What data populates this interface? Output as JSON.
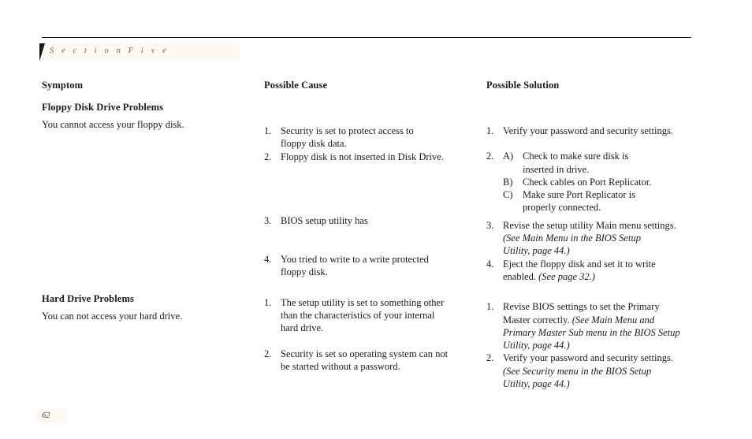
{
  "header": {
    "section_label": "S e c t i o n     F i v e"
  },
  "columns": {
    "symptom_heading": "Symptom",
    "cause_heading": "Possible Cause",
    "solution_heading": "Possible Solution"
  },
  "sections": [
    {
      "title": "Floppy Disk Drive Problems",
      "symptom": "You cannot access your floppy disk.",
      "causes": [
        {
          "mark": "1.",
          "text": "Security is set to protect access to",
          "cont": "floppy disk data."
        },
        {
          "mark": "2.",
          "text": "Floppy disk is not inserted in Disk Drive.",
          "cont": ""
        },
        {
          "mark": "3.",
          "text": "BIOS setup utility has",
          "cont": ""
        },
        {
          "mark": "4.",
          "text": "You tried to write to a write protected",
          "cont": "floppy disk."
        }
      ],
      "solutions": [
        {
          "mark": "1.",
          "text": "Verify your password and security settings.",
          "cont": ""
        },
        {
          "mark": "2.",
          "sub_mark": "A)",
          "text": "Check to make sure disk is",
          "cont": "inserted in drive."
        },
        {
          "mark": "",
          "sub_mark": "B)",
          "text": "Check cables on Port Replicator.",
          "cont": ""
        },
        {
          "mark": "",
          "sub_mark": "C)",
          "text": "Make sure Port Replicator is",
          "cont": "properly connected."
        },
        {
          "mark": "3.",
          "text": "Revise the setup utility Main menu settings.",
          "italic1": "(See Main Menu in the BIOS Setup",
          "italic2": "Utility, page 44.)"
        },
        {
          "mark": "4.",
          "text": "Eject the floppy disk and set it to write",
          "cont_plain": "enabled. ",
          "cont_italic": "(See page 32.)"
        }
      ]
    },
    {
      "title": "Hard Drive Problems",
      "symptom": "You can not access your hard drive.",
      "causes": [
        {
          "mark": "1.",
          "text": "The setup utility is set to something other",
          "cont": "than the characteristics of your internal",
          "cont2": "hard drive."
        },
        {
          "mark": "2.",
          "text": "Security is set so operating system can not",
          "cont": "be started without a password."
        }
      ],
      "solutions": [
        {
          "mark": "1.",
          "text": "Revise BIOS settings to set the Primary",
          "cont_plain": "Master correctly. ",
          "cont_italic": "(See Main Menu and",
          "italic2": "Primary Master Sub menu in the BIOS Setup",
          "italic3": "Utility, page 44.)"
        },
        {
          "mark": "2.",
          "text": "Verify your password and security settings.",
          "italic1": "(See Security menu in the BIOS Setup",
          "italic2": "Utility, page 44.)"
        }
      ]
    }
  ],
  "footer": {
    "page_number": "62"
  }
}
